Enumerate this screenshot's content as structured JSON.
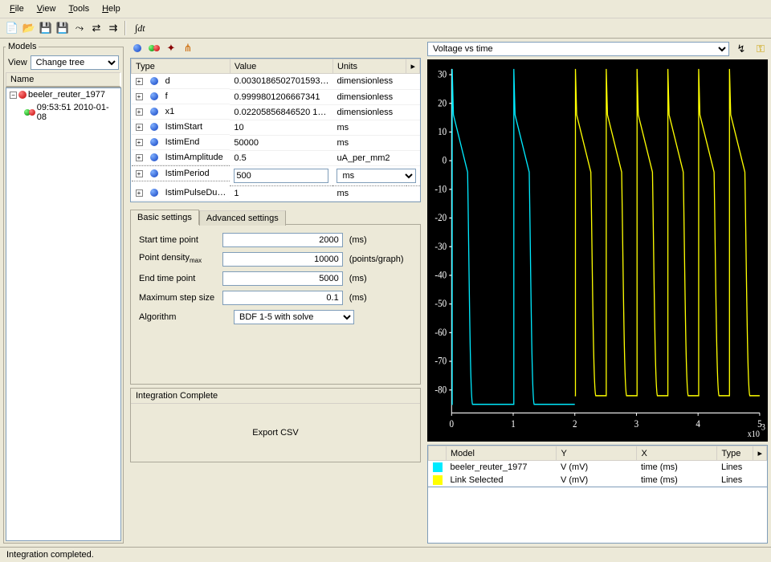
{
  "menu": {
    "file": "File",
    "view": "View",
    "tools": "Tools",
    "help": "Help"
  },
  "models_panel": {
    "legend": "Models",
    "view_label": "View",
    "tree_selector": "Change tree",
    "col_name": "Name",
    "root": "beeler_reuter_1977",
    "child": "09:53:51 2010-01-08"
  },
  "varcols": {
    "type": "Type",
    "value": "Value",
    "units": "Units"
  },
  "variables": [
    {
      "name": "d",
      "value": "0.0030186502701593…",
      "units": "dimensionless"
    },
    {
      "name": "f",
      "value": "0.9999801206667341",
      "units": "dimensionless"
    },
    {
      "name": "x1",
      "value": "0.02205856846520 1…",
      "units": "dimensionless"
    },
    {
      "name": "IstimStart",
      "value": "10",
      "units": "ms"
    },
    {
      "name": "IstimEnd",
      "value": "50000",
      "units": "ms"
    },
    {
      "name": "IstimAmplitude",
      "value": "0.5",
      "units": "uA_per_mm2"
    }
  ],
  "editing": {
    "name": "IstimPeriod",
    "value": "500",
    "units": "ms"
  },
  "after_edit": [
    {
      "name": "IstimPulseDu…",
      "value": "1",
      "units": "ms"
    }
  ],
  "tabs": {
    "basic": "Basic settings",
    "advanced": "Advanced settings"
  },
  "settings": {
    "start_label": "Start time point",
    "start_value": "2000",
    "start_unit": "(ms)",
    "density_label": "Point density",
    "density_sub": "max",
    "density_value": "10000",
    "density_unit": "(points/graph)",
    "end_label": "End time point",
    "end_value": "5000",
    "end_unit": "(ms)",
    "step_label": "Maximum step size",
    "step_value": "0.1",
    "step_unit": "(ms)",
    "algo_label": "Algorithm",
    "algo_value": "BDF 1-5 with solve"
  },
  "export": {
    "header": "Integration Complete",
    "button": "Export CSV"
  },
  "plot": {
    "selector": "Voltage vs time",
    "xnote": "x10",
    "xexp": "3",
    "yticks": [
      "30",
      "20",
      "10",
      "0",
      "-10",
      "-20",
      "-30",
      "-40",
      "-50",
      "-60",
      "-70",
      "-80"
    ],
    "xticks": [
      "0",
      "1",
      "2",
      "3",
      "4",
      "5"
    ]
  },
  "legendcols": {
    "model": "Model",
    "y": "Y",
    "x": "X",
    "type": "Type"
  },
  "legend": [
    {
      "color": "#00eaff",
      "model": "beeler_reuter_1977",
      "y": "V (mV)",
      "x": "time (ms)",
      "type": "Lines"
    },
    {
      "color": "#ffff00",
      "model": "Link Selected",
      "y": "V (mV)",
      "x": "time (ms)",
      "type": "Lines"
    }
  ],
  "status": "Integration completed.",
  "chart_data": {
    "type": "line",
    "title": "Voltage vs time",
    "xlabel": "time (ms)",
    "ylabel": "V (mV)",
    "xlim": [
      0,
      5000
    ],
    "ylim": [
      -88,
      32
    ],
    "series": [
      {
        "name": "beeler_reuter_1977",
        "color": "#00eaff",
        "period_ms": 1000,
        "x_range": [
          0,
          2000
        ],
        "spikes_at": [
          10,
          1010
        ],
        "peak_mV": 32,
        "plateau_mV": 16,
        "repolarize_end_mV": -85,
        "rest_mV": -85,
        "plateau_duration_ms": 250,
        "repolarize_duration_ms": 80
      },
      {
        "name": "Link Selected",
        "color": "#ffff00",
        "period_ms": 500,
        "x_range": [
          2000,
          5000
        ],
        "spikes_at": [
          2010,
          2510,
          3010,
          3510,
          4010,
          4510
        ],
        "peak_mV": 32,
        "plateau_mV": 16,
        "repolarize_end_mV": -82,
        "rest_mV": -82,
        "plateau_duration_ms": 250,
        "repolarize_duration_ms": 80
      }
    ]
  }
}
